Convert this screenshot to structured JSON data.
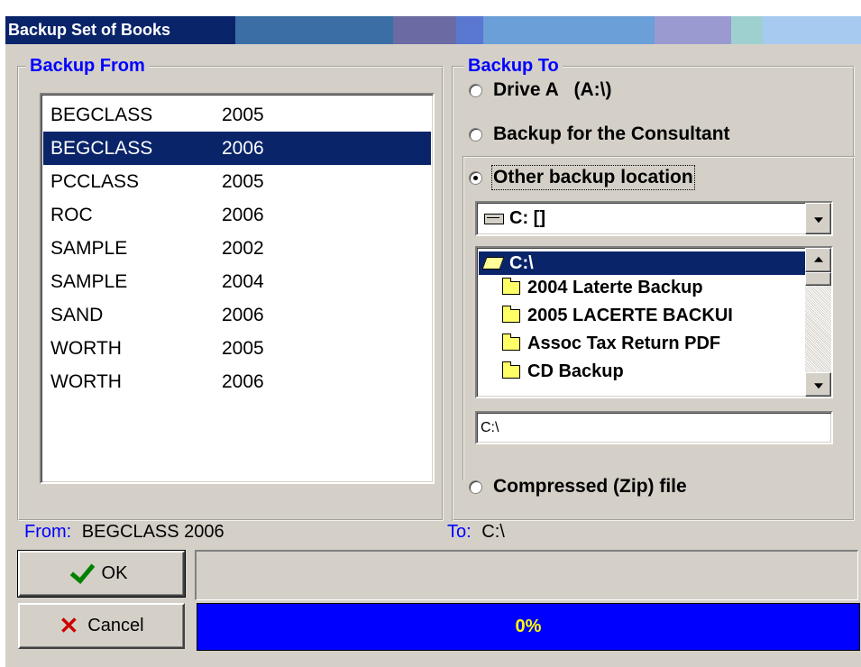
{
  "window": {
    "title": "Backup Set of Books"
  },
  "backup_from": {
    "legend": "Backup From",
    "books": [
      {
        "name": "BEGCLASS",
        "year": "2005"
      },
      {
        "name": "BEGCLASS",
        "year": "2006",
        "selected": true
      },
      {
        "name": "PCCLASS",
        "year": "2005"
      },
      {
        "name": "ROC",
        "year": "2006"
      },
      {
        "name": "SAMPLE",
        "year": "2002"
      },
      {
        "name": "SAMPLE",
        "year": "2004"
      },
      {
        "name": "SAND",
        "year": "2006"
      },
      {
        "name": "WORTH",
        "year": "2005"
      },
      {
        "name": "WORTH",
        "year": "2006"
      }
    ]
  },
  "backup_to": {
    "legend": "Backup To",
    "options": {
      "drive_a": "Drive A   (A:\\)",
      "consultant": "Backup for the Consultant",
      "other": "Other backup location",
      "zip": "Compressed (Zip) file"
    },
    "selected_option": "other",
    "drive_select": {
      "value": "C: []"
    },
    "folders": {
      "root": "C:\\",
      "items": [
        "2004 Laterte Backup",
        "2005 LACERTE BACKUI",
        "Assoc Tax Return PDF",
        "CD Backup"
      ]
    },
    "path_input": "C:\\"
  },
  "status": {
    "from_label": "From:",
    "from_value": "BEGCLASS 2006",
    "to_label": "To:",
    "to_value": "C:\\"
  },
  "buttons": {
    "ok": "OK",
    "cancel": "Cancel"
  },
  "progress": {
    "percent_text": "0%",
    "value": 0
  },
  "colors": {
    "selection": "#0a246a",
    "legend": "#0000ff",
    "progress_fill": "#0000ff",
    "progress_text": "#ffff00",
    "ok_check": "#008000",
    "cancel_x": "#cc0000"
  },
  "icons": {
    "ok": "checkmark-icon",
    "cancel": "x-icon",
    "drive": "hard-drive-icon",
    "open_folder": "open-folder-icon",
    "folder": "folder-icon"
  }
}
